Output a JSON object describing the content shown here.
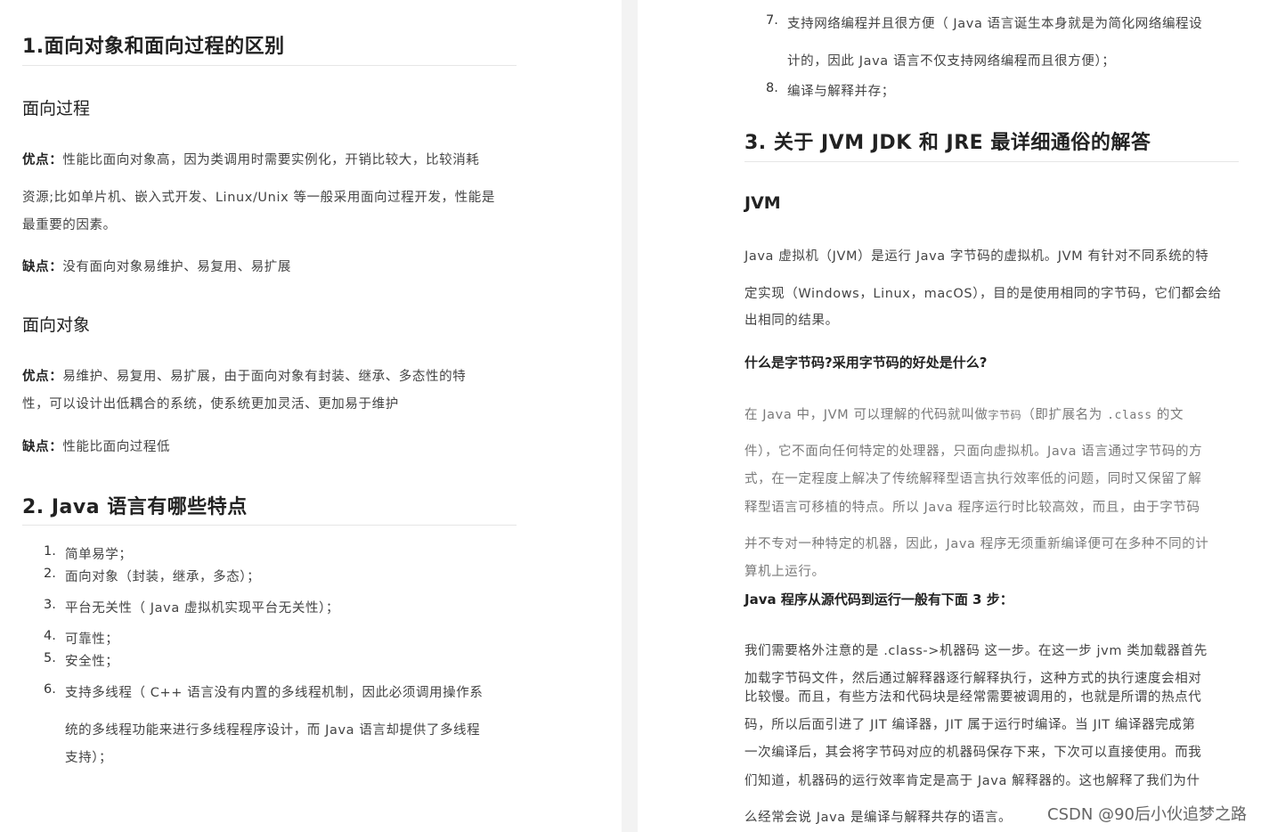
{
  "left": {
    "h1_title": "1.面向对象和面向过程的区别",
    "section_procedural": {
      "title": "面向过程",
      "pros_label": "优点：",
      "pros_line1": "性能比面向对象高，因为类调用时需要实例化，开销比较大，比较消耗",
      "pros_line2": "资源;比如单片机、嵌入式开发、Linux/Unix 等一般采用面向过程开发，性能是",
      "pros_line3": "最重要的因素。",
      "cons_label": "缺点：",
      "cons_text": "没有面向对象易维护、易复用、易扩展"
    },
    "section_oo": {
      "title": "面向对象",
      "pros_label": "优点：",
      "pros_line1": "易维护、易复用、易扩展，由于面向对象有封装、继承、多态性的特",
      "pros_line2": "性，可以设计出低耦合的系统，使系统更加灵活、更加易于维护",
      "cons_label": "缺点：",
      "cons_text": "性能比面向过程低"
    },
    "h2_title": "2. Java  语言有哪些特点",
    "features": [
      {
        "num": "1.",
        "text": "简单易学；"
      },
      {
        "num": "2.",
        "text": "面向对象（封装，继承，多态）；"
      },
      {
        "num": "3.",
        "text": "平台无关性（ Java  虚拟机实现平台无关性）；"
      },
      {
        "num": "4.",
        "text": "可靠性；"
      },
      {
        "num": "5.",
        "text": "安全性；"
      },
      {
        "num": "6.",
        "text": "支持多线程（ C++  语言没有内置的多线程机制，因此必须调用操作系",
        "line2": "统的多线程功能来进行多线程程序设计，而  Java  语言却提供了多线程",
        "line3": "支持）；"
      }
    ]
  },
  "right": {
    "feature7": {
      "num": "7.",
      "line1": "支持网络编程并且很方便（  Java  语言诞生本身就是为简化网络编程设",
      "line2": "计的，因此  Java  语言不仅支持网络编程而且很方便）；"
    },
    "feature8": {
      "num": "8.",
      "text": "编译与解释并存；"
    },
    "h3_title": "3.  关于  JVM JDK  和  JRE  最详细通俗的解答",
    "jvm_heading": "JVM",
    "jvm_para_line1": "Java 虚拟机（JVM）是运行  Java  字节码的虚拟机。JVM 有针对不同系统的特",
    "jvm_para_line2": "定实现（Windows，Linux，macOS），目的是使用相同的字节码，它们都会给",
    "jvm_para_line3": "出相同的结果。",
    "bytecode_q": "什么是字节码?采用字节码的好处是什么?",
    "bytecode_p1_pre": "在  Java  中，JVM 可以理解的代码就叫做",
    "bytecode_p1_small": "字节码",
    "bytecode_p1_mid": "（即扩展名为 ",
    "bytecode_p1_code": ".class",
    "bytecode_p1_post": " 的文",
    "bytecode_p2": "件），它不面向任何特定的处理器，只面向虚拟机。Java  语言通过字节码的方",
    "bytecode_p3": "式，在一定程度上解决了传统解释型语言执行效率低的问题，同时又保留了解",
    "bytecode_p4": "释型语言可移植的特点。所以  Java  程序运行时比较高效，而且，由于字节码",
    "bytecode_p5": "并不专对一种特定的机器，因此，Java 程序无须重新编译便可在多种不同的计",
    "bytecode_p6": "算机上运行。",
    "steps_heading": "Java  程序从源代码到运行一般有下面 3 步：",
    "steps_p1": "我们需要格外注意的是  .class->机器码  这一步。在这一步  jvm  类加载器首先",
    "steps_p2": "加载字节码文件，然后通过解释器逐行解释执行，这种方式的执行速度会相对",
    "steps_p3": "比较慢。而且，有些方法和代码块是经常需要被调用的，也就是所谓的热点代",
    "steps_p4": "码，所以后面引进了  JIT  编译器，JIT  属于运行时编译。当  JIT  编译器完成第",
    "steps_p5": "一次编译后，其会将字节码对应的机器码保存下来，下次可以直接使用。而我",
    "steps_p6": "们知道，机器码的运行效率肯定是高于  Java  解释器的。这也解释了我们为什",
    "steps_p7": "么经常会说  Java  是编译与解释共存的语言。"
  },
  "watermark": "CSDN @90后小伙追梦之路"
}
